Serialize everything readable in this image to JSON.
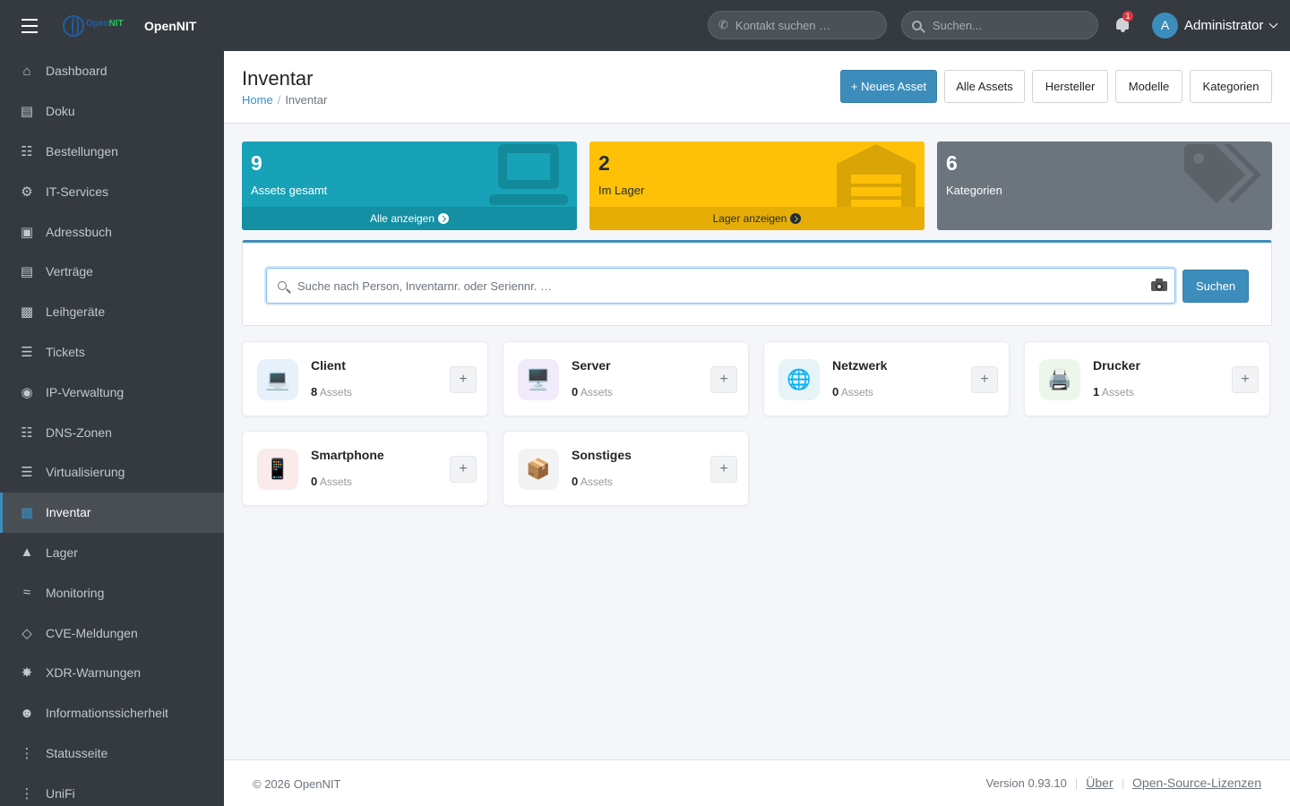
{
  "app": {
    "name": "OpenNIT",
    "logo_text_a": "Open",
    "logo_text_b": "NIT"
  },
  "topbar": {
    "contact_search_placeholder": "Kontakt suchen …",
    "global_search_placeholder": "Suchen...",
    "notification_count": "1",
    "user_initial": "A",
    "user_name": "Administrator"
  },
  "sidebar": {
    "items": [
      {
        "label": "Dashboard",
        "icon": "home-icon"
      },
      {
        "label": "Doku",
        "icon": "book-icon"
      },
      {
        "label": "Bestellungen",
        "icon": "cart-icon"
      },
      {
        "label": "IT-Services",
        "icon": "gear-icon"
      },
      {
        "label": "Adressbuch",
        "icon": "address-book-icon"
      },
      {
        "label": "Verträge",
        "icon": "contract-icon"
      },
      {
        "label": "Leihgeräte",
        "icon": "laptop-icon"
      },
      {
        "label": "Tickets",
        "icon": "ticket-icon"
      },
      {
        "label": "IP-Verwaltung",
        "icon": "globe-icon"
      },
      {
        "label": "DNS-Zonen",
        "icon": "sitemap-icon"
      },
      {
        "label": "Virtualisierung",
        "icon": "server-icon"
      },
      {
        "label": "Inventar",
        "icon": "boxes-icon",
        "active": true
      },
      {
        "label": "Lager",
        "icon": "warehouse-icon"
      },
      {
        "label": "Monitoring",
        "icon": "chart-line-icon"
      },
      {
        "label": "CVE-Meldungen",
        "icon": "shield-icon"
      },
      {
        "label": "XDR-Warnungen",
        "icon": "shield-virus-icon"
      },
      {
        "label": "Informationssicherheit",
        "icon": "user-lock-icon"
      },
      {
        "label": "Statusseite",
        "icon": "traffic-light-icon"
      },
      {
        "label": "UniFi",
        "icon": "network-icon"
      }
    ]
  },
  "header": {
    "title": "Inventar",
    "breadcrumb_home": "Home",
    "breadcrumb_current": "Inventar",
    "buttons": {
      "new_asset": "+ Neues Asset",
      "all_assets": "Alle Assets",
      "manufacturer": "Hersteller",
      "models": "Modelle",
      "categories": "Kategorien"
    }
  },
  "stats": {
    "total": {
      "value": "9",
      "label": "Assets gesamt",
      "link": "Alle anzeigen"
    },
    "storage": {
      "value": "2",
      "label": "Im Lager",
      "link": "Lager anzeigen"
    },
    "categories": {
      "value": "6",
      "label": "Kategorien"
    }
  },
  "search": {
    "placeholder": "Suche nach Person, Inventarnr. oder Seriennr. …",
    "button": "Suchen"
  },
  "categories": [
    {
      "name": "Client",
      "count": "8",
      "unit": "Assets",
      "emoji": "💻",
      "bg": "#e7f1fb"
    },
    {
      "name": "Server",
      "count": "0",
      "unit": "Assets",
      "emoji": "🖥️",
      "bg": "#f0eafb"
    },
    {
      "name": "Netzwerk",
      "count": "0",
      "unit": "Assets",
      "emoji": "🌐",
      "bg": "#e6f4f7"
    },
    {
      "name": "Drucker",
      "count": "1",
      "unit": "Assets",
      "emoji": "🖨️",
      "bg": "#ecf6ea"
    },
    {
      "name": "Smartphone",
      "count": "0",
      "unit": "Assets",
      "emoji": "📱",
      "bg": "#fbeaea"
    },
    {
      "name": "Sonstiges",
      "count": "0",
      "unit": "Assets",
      "emoji": "📦",
      "bg": "#f3f3f3"
    }
  ],
  "footer": {
    "copyright": "© 2026 OpenNIT",
    "version": "Version 0.93.10",
    "about": "Über",
    "licenses": "Open-Source-Lizenzen"
  },
  "colors": {
    "accent": "#3c8dbc",
    "teal": "#17a2b8",
    "yellow": "#ffc107",
    "gray": "#6c757d",
    "sidebar": "#343a40"
  }
}
